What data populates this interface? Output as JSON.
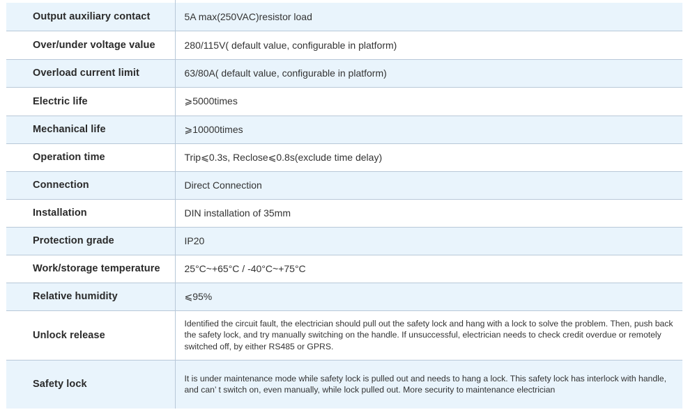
{
  "spec_table": {
    "rows": [
      {
        "label": "Output auxiliary contact",
        "value": "5A max(250VAC)resistor load",
        "shaded": true
      },
      {
        "label": "Over/under voltage value",
        "value": "280/115V( default value, configurable in platform)",
        "shaded": false
      },
      {
        "label": "Overload current limit",
        "value": "63/80A( default value, configurable in platform)",
        "shaded": true
      },
      {
        "label": "Electric life",
        "value": "⩾5000times",
        "shaded": false
      },
      {
        "label": "Mechanical life",
        "value": "⩾10000times",
        "shaded": true
      },
      {
        "label": "Operation time",
        "value": "Trip⩽0.3s, Reclose⩽0.8s(exclude time delay)",
        "shaded": false
      },
      {
        "label": "Connection",
        "value": "Direct Connection",
        "shaded": true
      },
      {
        "label": "Installation",
        "value": "DIN installation of 35mm",
        "shaded": false
      },
      {
        "label": "Protection grade",
        "value": "IP20",
        "shaded": true
      },
      {
        "label": "Work/storage temperature",
        "value": "25°C~+65°C / -40°C~+75°C",
        "shaded": false
      },
      {
        "label": "Relative humidity",
        "value": "⩽95%",
        "shaded": true
      },
      {
        "label": "Unlock release",
        "value": "Identified the circuit fault, the electrician should pull out the safety lock and hang with a lock to solve the problem. Then, push back the safety lock, and try manually switching on the handle. If unsuccessful, electrician needs to check credit overdue or remotely switched off, by either RS485 or GPRS.",
        "shaded": false
      },
      {
        "label": "Safety lock",
        "value": "It is under maintenance mode while safety lock is pulled out and needs to hang a lock. This safety lock has interlock with handle, and can’ t switch on, even manually, while lock pulled out. More security to maintenance electrician",
        "shaded": true
      }
    ]
  }
}
